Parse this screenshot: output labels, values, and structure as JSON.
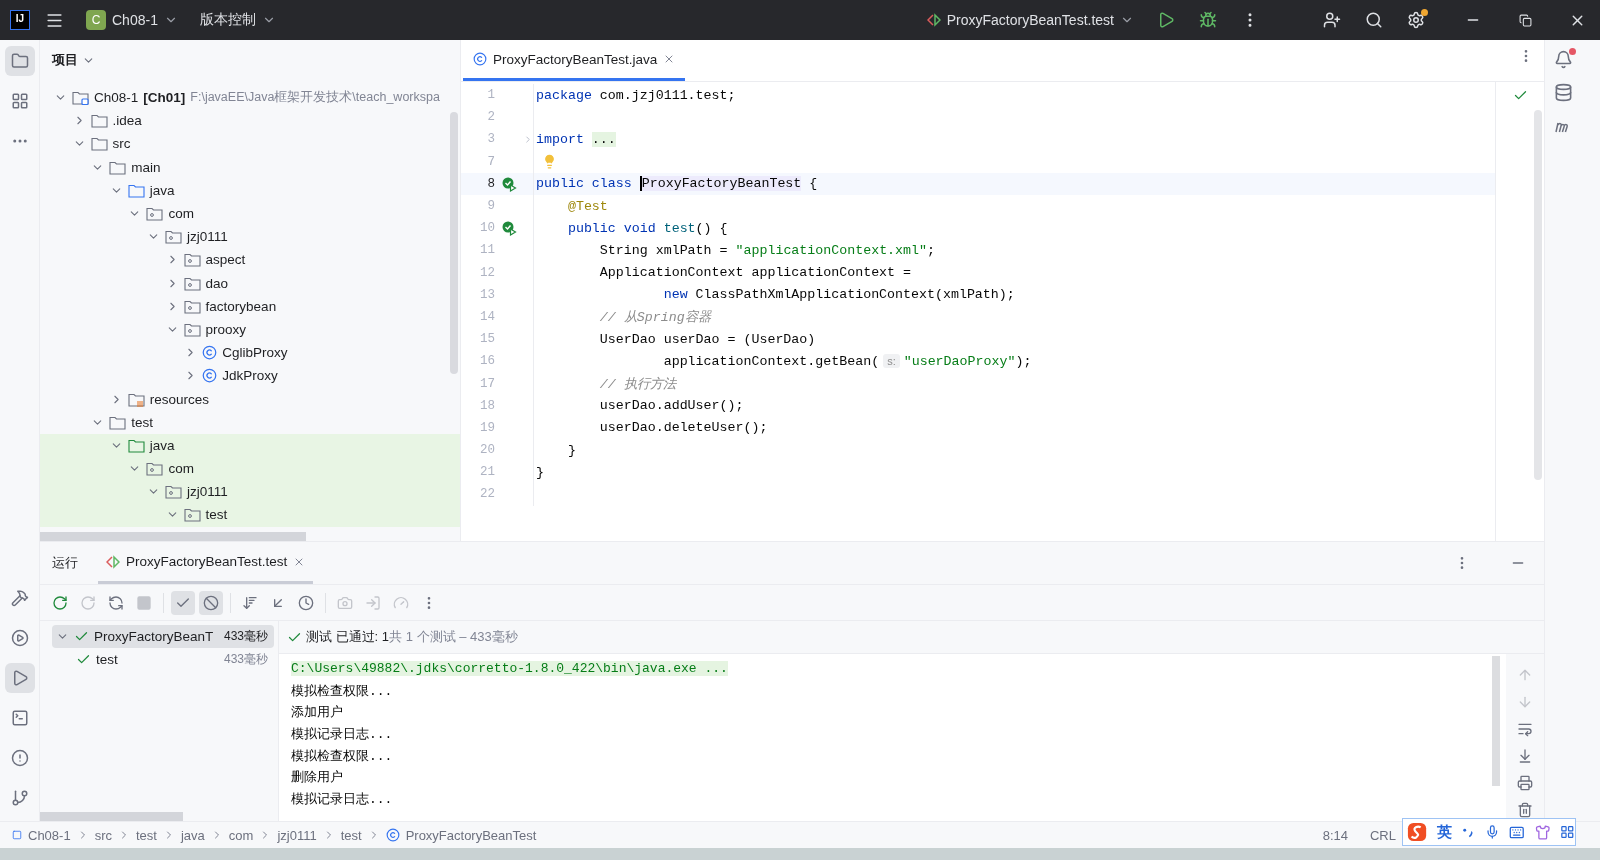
{
  "title_bar": {
    "logo": "IJ",
    "project": {
      "badge": "C",
      "name": "Ch08-1"
    },
    "vcs": "版本控制",
    "run_config": "ProxyFactoryBeanTest.test"
  },
  "left_toolbar": {
    "top": [
      {
        "kind": "project",
        "selected": true
      },
      {
        "kind": "structure",
        "selected": false
      },
      {
        "kind": "more",
        "selected": false
      }
    ],
    "bottom": [
      {
        "kind": "build",
        "selected": false
      },
      {
        "kind": "services",
        "selected": false
      },
      {
        "kind": "run",
        "selected": true
      },
      {
        "kind": "terminal",
        "selected": false
      },
      {
        "kind": "problems",
        "selected": false
      },
      {
        "kind": "git",
        "selected": false
      }
    ]
  },
  "project_panel": {
    "title": "项目",
    "tree": [
      {
        "kind": "module",
        "label": "Ch08-1",
        "tag": "[Ch01]",
        "path": "F:\\javaEE\\Java框架开发技术\\teach_workspa",
        "expanded": true,
        "highlighted": false,
        "children": [
          {
            "kind": "folder",
            "label": ".idea",
            "expanded": false,
            "highlighted": false
          },
          {
            "kind": "folder",
            "label": "src",
            "expanded": true,
            "highlighted": false,
            "children": [
              {
                "kind": "folder",
                "label": "main",
                "expanded": true,
                "highlighted": false,
                "children": [
                  {
                    "kind": "source-root",
                    "label": "java",
                    "expanded": true,
                    "highlighted": false,
                    "children": [
                      {
                        "kind": "package",
                        "label": "com",
                        "expanded": true,
                        "highlighted": false,
                        "children": [
                          {
                            "kind": "package",
                            "label": "jzj0111",
                            "expanded": true,
                            "highlighted": false,
                            "children": [
                              {
                                "kind": "package",
                                "label": "aspect",
                                "expanded": false,
                                "highlighted": false
                              },
                              {
                                "kind": "package",
                                "label": "dao",
                                "expanded": false,
                                "highlighted": false
                              },
                              {
                                "kind": "package",
                                "label": "factorybean",
                                "expanded": false,
                                "highlighted": false
                              },
                              {
                                "kind": "package",
                                "label": "prooxy",
                                "expanded": true,
                                "highlighted": false,
                                "children": [
                                  {
                                    "kind": "class",
                                    "label": "CglibProxy",
                                    "expanded": false,
                                    "highlighted": false
                                  },
                                  {
                                    "kind": "class",
                                    "label": "JdkProxy",
                                    "expanded": false,
                                    "highlighted": false
                                  }
                                ]
                              }
                            ]
                          }
                        ]
                      }
                    ]
                  },
                  {
                    "kind": "resources-root",
                    "label": "resources",
                    "expanded": false,
                    "highlighted": false
                  }
                ]
              },
              {
                "kind": "folder",
                "label": "test",
                "expanded": true,
                "highlighted": false,
                "children": [
                  {
                    "kind": "test-root",
                    "label": "java",
                    "expanded": true,
                    "highlighted": true,
                    "children": [
                      {
                        "kind": "package",
                        "label": "com",
                        "expanded": true,
                        "highlighted": true,
                        "children": [
                          {
                            "kind": "package",
                            "label": "jzj0111",
                            "expanded": true,
                            "highlighted": true,
                            "children": [
                              {
                                "kind": "package",
                                "label": "test",
                                "expanded": true,
                                "highlighted": true
                              }
                            ]
                          }
                        ]
                      }
                    ]
                  }
                ]
              }
            ]
          }
        ]
      }
    ]
  },
  "editor": {
    "tabs": [
      {
        "label": "ProxyFactoryBeanTest.java",
        "selected": true
      }
    ],
    "lines": [
      {
        "number": "1",
        "kind": "code",
        "current": false,
        "tokens": [
          {
            "kind": "keyword",
            "text": "package"
          },
          {
            "kind": "plain",
            "text": " com.jzj0111.test;"
          }
        ]
      },
      {
        "number": "2",
        "kind": "code",
        "current": false
      },
      {
        "number": "3",
        "kind": "fold",
        "current": false,
        "tokens": [
          {
            "kind": "keyword",
            "text": "import "
          },
          {
            "kind": "folded",
            "text": "..."
          }
        ]
      },
      {
        "number": "7",
        "kind": "bulb",
        "current": false
      },
      {
        "number": "8",
        "kind": "run",
        "current": true,
        "tokens": [
          {
            "kind": "keyword",
            "text": "public class "
          },
          {
            "kind": "caret",
            "text": "ProxyFactoryBeanTest"
          },
          {
            "kind": "plain",
            "text": " {"
          }
        ]
      },
      {
        "number": "9",
        "kind": "code",
        "current": false,
        "tokens": [
          {
            "kind": "annotation",
            "text": "    @Test"
          }
        ]
      },
      {
        "number": "10",
        "kind": "run",
        "current": false,
        "tokens": [
          {
            "kind": "keyword",
            "text": "    public void "
          },
          {
            "kind": "method",
            "text": "test"
          },
          {
            "kind": "plain",
            "text": "() {"
          }
        ]
      },
      {
        "number": "11",
        "kind": "code",
        "current": false,
        "tokens": [
          {
            "kind": "plain",
            "text": "        String xmlPath = "
          },
          {
            "kind": "string",
            "text": "\"applicationContext.xml\""
          },
          {
            "kind": "plain",
            "text": ";"
          }
        ]
      },
      {
        "number": "12",
        "kind": "code",
        "current": false,
        "tokens": [
          {
            "kind": "plain",
            "text": "        ApplicationContext applicationContext ="
          }
        ]
      },
      {
        "number": "13",
        "kind": "code",
        "current": false,
        "tokens": [
          {
            "kind": "keyword",
            "text": "                new"
          },
          {
            "kind": "plain",
            "text": " ClassPathXmlApplicationContext(xmlPath);"
          }
        ]
      },
      {
        "number": "14",
        "kind": "code",
        "current": false,
        "tokens": [
          {
            "kind": "comment",
            "text": "        // 从Spring容器"
          }
        ]
      },
      {
        "number": "15",
        "kind": "code",
        "current": false,
        "tokens": [
          {
            "kind": "plain",
            "text": "        UserDao userDao = (UserDao)"
          }
        ]
      },
      {
        "number": "16",
        "kind": "code",
        "current": false,
        "tokens": [
          {
            "kind": "plain",
            "text": "                applicationContext.getBean("
          },
          {
            "kind": "hint",
            "text": "s:"
          },
          {
            "kind": "string",
            "text": "\"userDaoProxy\""
          },
          {
            "kind": "plain",
            "text": ");"
          }
        ]
      },
      {
        "number": "17",
        "kind": "code",
        "current": false,
        "tokens": [
          {
            "kind": "comment",
            "text": "        // 执行方法"
          }
        ]
      },
      {
        "number": "18",
        "kind": "code",
        "current": false,
        "tokens": [
          {
            "kind": "plain",
            "text": "        userDao.addUser();"
          }
        ]
      },
      {
        "number": "19",
        "kind": "code",
        "current": false,
        "tokens": [
          {
            "kind": "plain",
            "text": "        userDao.deleteUser();"
          }
        ]
      },
      {
        "number": "20",
        "kind": "code",
        "current": false,
        "tokens": [
          {
            "kind": "plain",
            "text": "    }"
          }
        ]
      },
      {
        "number": "21",
        "kind": "code",
        "current": false,
        "tokens": [
          {
            "kind": "plain",
            "text": "}"
          }
        ]
      },
      {
        "number": "22",
        "kind": "code",
        "current": false
      }
    ]
  },
  "right_toolbar": [
    {
      "kind": "notifications",
      "badge": true
    },
    {
      "kind": "database",
      "badge": false
    },
    {
      "kind": "maven",
      "badge": false
    }
  ],
  "run_panel": {
    "title": "运行",
    "tabs": [
      {
        "label": "ProxyFactoryBeanTest.test",
        "selected": true
      }
    ],
    "toolbar": [
      {
        "kind": "rerun",
        "disabled": false,
        "toggled": false
      },
      {
        "kind": "rerun-failed",
        "disabled": true,
        "toggled": false
      },
      {
        "kind": "auto-test",
        "disabled": false,
        "toggled": false
      },
      {
        "kind": "stop",
        "disabled": true,
        "toggled": false
      },
      {
        "kind": "separator"
      },
      {
        "kind": "show-passed",
        "disabled": false,
        "toggled": true
      },
      {
        "kind": "show-ignored",
        "disabled": false,
        "toggled": true
      },
      {
        "kind": "separator"
      },
      {
        "kind": "sort",
        "disabled": false,
        "toggled": false
      },
      {
        "kind": "collapse",
        "disabled": false,
        "toggled": false
      },
      {
        "kind": "history",
        "disabled": false,
        "toggled": false
      },
      {
        "kind": "separator"
      },
      {
        "kind": "screenshot",
        "disabled": true,
        "toggled": false
      },
      {
        "kind": "export",
        "disabled": true,
        "toggled": false
      },
      {
        "kind": "gauge",
        "disabled": true,
        "toggled": false
      },
      {
        "kind": "more",
        "disabled": false,
        "toggled": false
      }
    ],
    "tests": [
      {
        "name": "ProxyFactoryBeanT",
        "time": "433毫秒",
        "passed": true,
        "expanded": true,
        "selected": true,
        "children": [
          {
            "name": "test",
            "time": "433毫秒",
            "passed": true,
            "selected": false
          }
        ]
      }
    ],
    "summary": {
      "passed": true,
      "status": "测试 已通过: 1",
      "detail": "共 1 个测试 – 433毫秒"
    },
    "console": [
      {
        "kind": "command",
        "text": "C:\\Users\\49882\\.jdks\\corretto-1.8.0_422\\bin\\java.exe ..."
      },
      {
        "kind": "output",
        "text": "模拟检查权限..."
      },
      {
        "kind": "output",
        "text": "添加用户"
      },
      {
        "kind": "output",
        "text": "模拟记录日志..."
      },
      {
        "kind": "output",
        "text": "模拟检查权限..."
      },
      {
        "kind": "output",
        "text": "删除用户"
      },
      {
        "kind": "output",
        "text": "模拟记录日志..."
      }
    ],
    "console_actions": [
      {
        "kind": "up",
        "disabled": true
      },
      {
        "kind": "down",
        "disabled": true
      },
      {
        "kind": "wrap",
        "disabled": false
      },
      {
        "kind": "scroll-end",
        "disabled": false
      },
      {
        "kind": "print",
        "disabled": false
      },
      {
        "kind": "clear",
        "disabled": false
      }
    ]
  },
  "status_bar": {
    "breadcrumbs": [
      {
        "kind": "module",
        "label": "Ch08-1"
      },
      {
        "kind": "folder",
        "label": "src"
      },
      {
        "kind": "folder",
        "label": "test"
      },
      {
        "kind": "folder",
        "label": "java"
      },
      {
        "kind": "folder",
        "label": "com"
      },
      {
        "kind": "folder",
        "label": "jzj0111"
      },
      {
        "kind": "folder",
        "label": "test"
      },
      {
        "kind": "class",
        "label": "ProxyFactoryBeanTest"
      }
    ],
    "position": "8:14",
    "line_separator": "CRL"
  },
  "ime_toolbar": {
    "mode": "英"
  }
}
